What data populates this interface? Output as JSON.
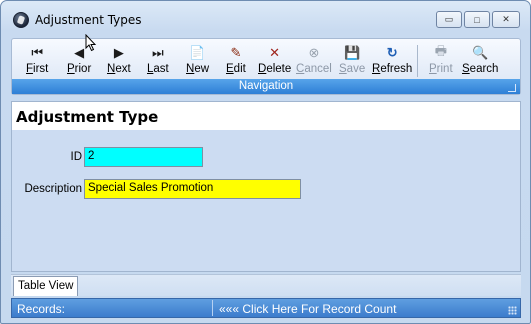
{
  "window": {
    "title": "Adjustment Types",
    "controls": {
      "minimize": "▭",
      "maximize": "□",
      "close": "✕"
    }
  },
  "toolbar": {
    "items": [
      {
        "label": "First",
        "icon": "first-record-icon",
        "glyph": "⏮",
        "enabled": true
      },
      {
        "label": "Prior",
        "icon": "prior-record-icon",
        "glyph": "◀",
        "enabled": true
      },
      {
        "label": "Next",
        "icon": "next-record-icon",
        "glyph": "▶",
        "enabled": true
      },
      {
        "label": "Last",
        "icon": "last-record-icon",
        "glyph": "⏭",
        "enabled": true
      },
      {
        "label": "New",
        "icon": "new-document-icon",
        "glyph": "📄",
        "enabled": true
      },
      {
        "label": "Edit",
        "icon": "edit-pencil-icon",
        "glyph": "✎",
        "enabled": true
      },
      {
        "label": "Delete",
        "icon": "delete-x-icon",
        "glyph": "✕",
        "enabled": true
      },
      {
        "label": "Cancel",
        "icon": "cancel-icon",
        "glyph": "⊗",
        "enabled": false
      },
      {
        "label": "Save",
        "icon": "save-disk-icon",
        "glyph": "💾",
        "enabled": false
      },
      {
        "label": "Refresh",
        "icon": "refresh-icon",
        "glyph": "↻",
        "enabled": true
      },
      {
        "label": "Print",
        "icon": "printer-icon",
        "glyph": "🖶",
        "enabled": false
      },
      {
        "label": "Search",
        "icon": "search-magnifier-icon",
        "glyph": "🔍",
        "enabled": true
      }
    ],
    "group_label": "Navigation"
  },
  "form": {
    "heading": "Adjustment Type",
    "id_label": "ID",
    "id_value": "2",
    "description_label": "Description",
    "description_value": "Special Sales Promotion"
  },
  "tabs": {
    "table_view": "Table View"
  },
  "status": {
    "records_label": "Records:",
    "record_count_hint": "««« Click Here For Record Count"
  },
  "colors": {
    "id_field_bg": "#00ffff",
    "description_field_bg": "#ffff00",
    "navigation_bar": "#2e7fd6",
    "status_bar": "#3c7ccc"
  }
}
